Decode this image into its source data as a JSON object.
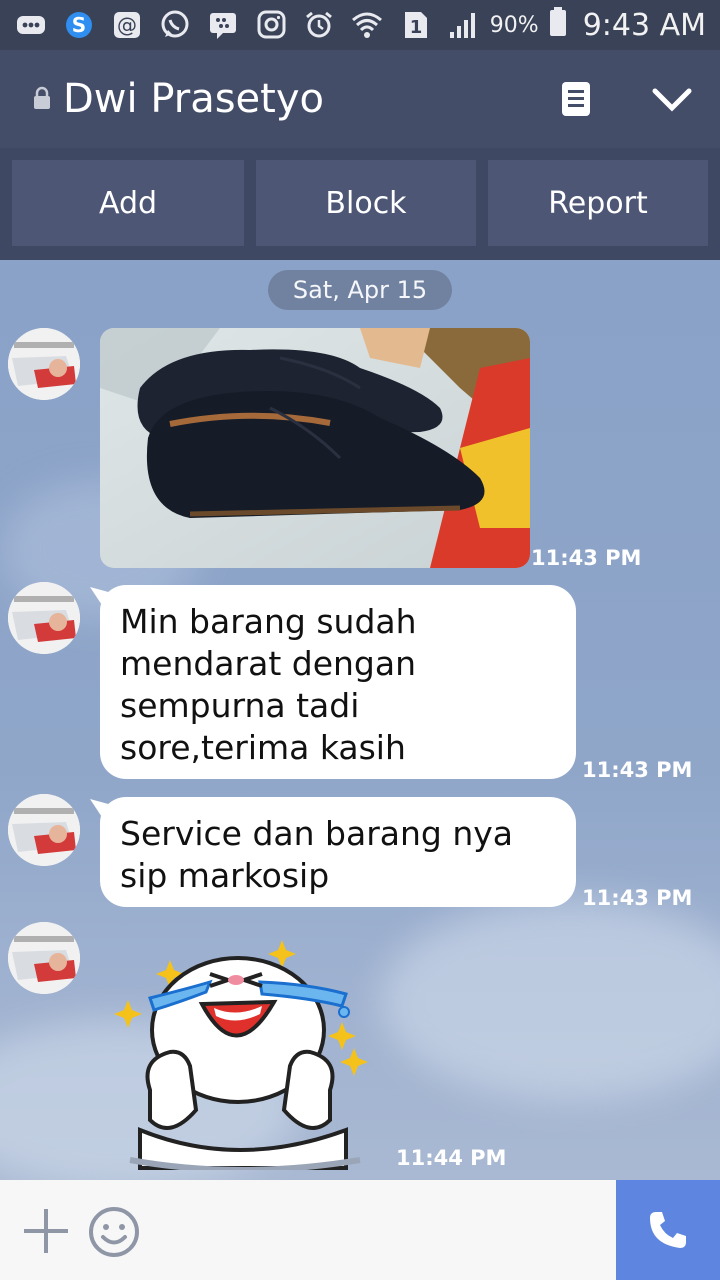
{
  "status_bar": {
    "icons": [
      "more-icon",
      "skype-icon",
      "at-icon",
      "whatsapp-icon",
      "bbm-icon",
      "instagram-icon",
      "alarm-icon",
      "wifi-icon",
      "sim-icon",
      "signal-icon"
    ],
    "sim_label": "1",
    "battery": "90%",
    "time": "9:43 AM"
  },
  "header": {
    "title": "Dwi Prasetyo"
  },
  "actions": {
    "add": "Add",
    "block": "Block",
    "report": "Report"
  },
  "chat": {
    "date": "Sat, Apr 15",
    "messages": [
      {
        "type": "image",
        "time": "11:43 PM"
      },
      {
        "type": "text",
        "text": "Min barang sudah mendarat dengan sempurna tadi sore,terima kasih",
        "time": "11:43 PM"
      },
      {
        "type": "text",
        "text": "Service dan barang nya sip markosip",
        "time": "11:43 PM"
      },
      {
        "type": "sticker",
        "time": "11:44 PM"
      }
    ]
  },
  "colors": {
    "header": "#444d68",
    "action_bar": "#3f4862",
    "call_button": "#5e86e0",
    "chat_bg": "#8ea3c6"
  }
}
